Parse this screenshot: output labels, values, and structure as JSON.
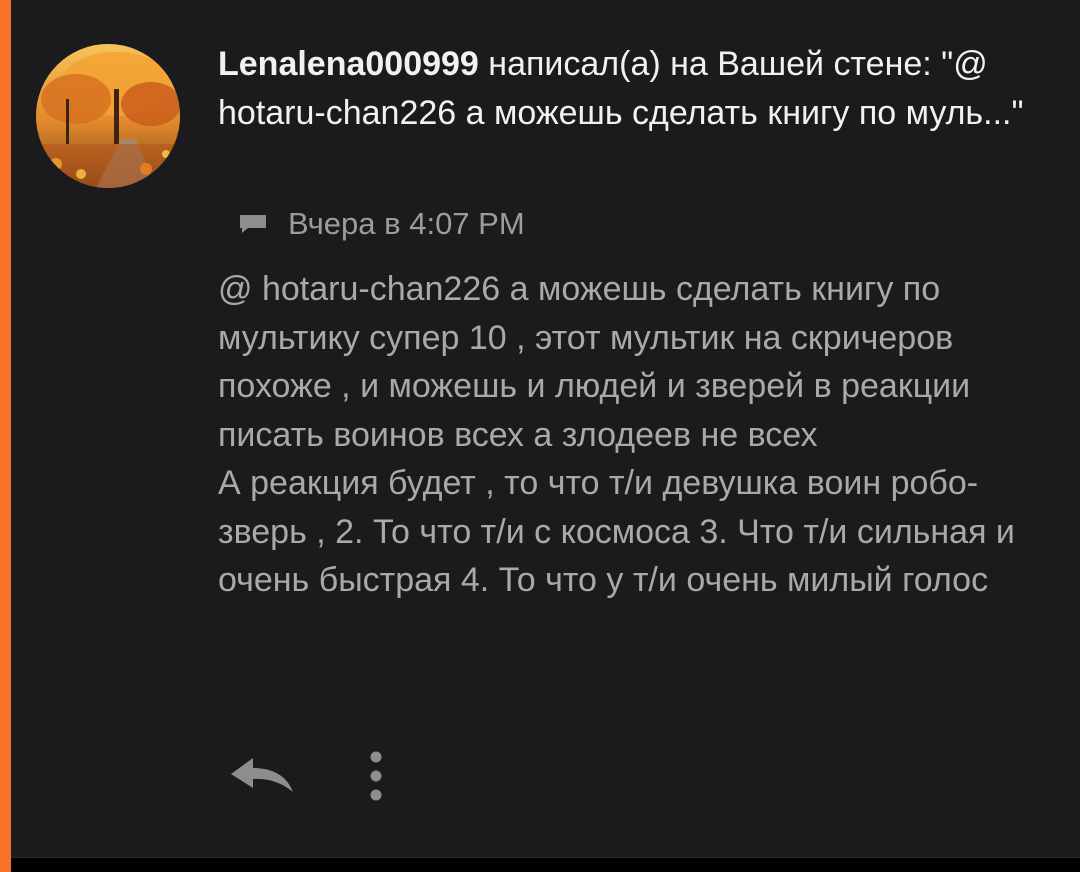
{
  "notification": {
    "username": "Lenalena000999",
    "action_text": " написал(а) на Вашей стене: \"@ hotaru-chan226 а можешь сделать книгу по муль...\"",
    "timestamp": "Вчера в 4:07 PM",
    "message": "@ hotaru-chan226   а можешь сделать книгу по мультику супер 10 , этот мультик на скричеров похоже , и можешь и людей и зверей в реакции писать воинов всех а злодеев не всех\nА реакция будет , то что т/и девушка воин робо-зверь , 2. То что т/и с космоса 3. Что т/и сильная и очень быстрая 4. То что у т/и очень милый голос"
  },
  "icons": {
    "avatar": "autumn-park-photo",
    "comment": "comment-icon",
    "reply": "reply-icon",
    "more": "more-vertical-icon"
  },
  "colors": {
    "accent": "#f9722c",
    "background": "#1b1a1d",
    "headline_text": "#f1f1f1",
    "body_text": "#a9a9a9",
    "meta_text": "#9c9c9c",
    "icon": "#8d8d8d"
  }
}
